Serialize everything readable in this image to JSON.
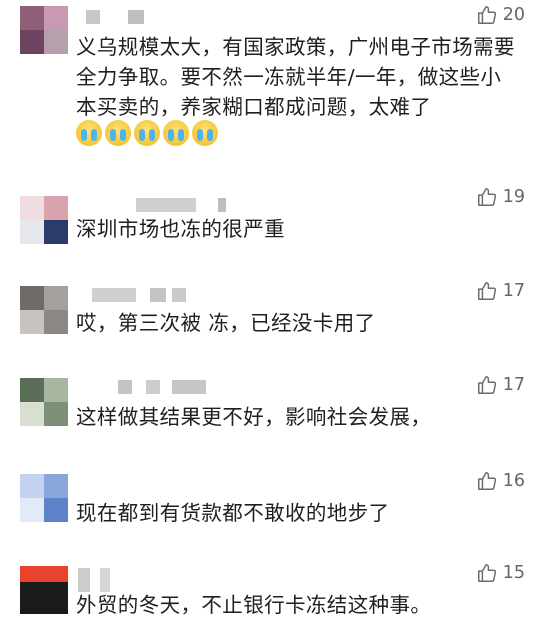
{
  "comments": [
    {
      "text": "义乌规模太大，有国家政策，广州电子市场需要全力争取。要不然一冻就半年/一年，做这些小本买卖的，养家糊口都成问题，太难了",
      "emoji_count": 5,
      "likes": "20",
      "avatar_colors": [
        "#8e5f76",
        "#c79ab1",
        "#6e4560",
        "#b7a0ad"
      ]
    },
    {
      "text": "深圳市场也冻的很严重",
      "likes": "19",
      "avatar_colors": [
        "#d9a3ad",
        "#f1dde1",
        "#2b3c6c",
        "#e7e7ee"
      ]
    },
    {
      "text": "哎，第三次被 冻，已经没卡用了",
      "likes": "17",
      "avatar_colors": [
        "#6d6a67",
        "#a4a19c",
        "#c7c4bf",
        "#8b8884"
      ]
    },
    {
      "text": "这样做其结果更不好，影响社会发展，",
      "likes": "17",
      "avatar_colors": [
        "#5b6e58",
        "#a8b6a0",
        "#d8ded2",
        "#7e8f78"
      ]
    },
    {
      "text": "现在都到有货款都不敢收的地步了",
      "likes": "16",
      "avatar_colors": [
        "#8aa7dc",
        "#c2d3f1",
        "#5e83c9",
        "#e3eaf7"
      ]
    },
    {
      "text": "外贸的冬天，不止银行卡冻结这种事。",
      "likes": "15",
      "avatar_colors": [
        "#e8432f",
        "#1a1a1a",
        "#f26a55",
        "#2a2a2a"
      ]
    }
  ]
}
